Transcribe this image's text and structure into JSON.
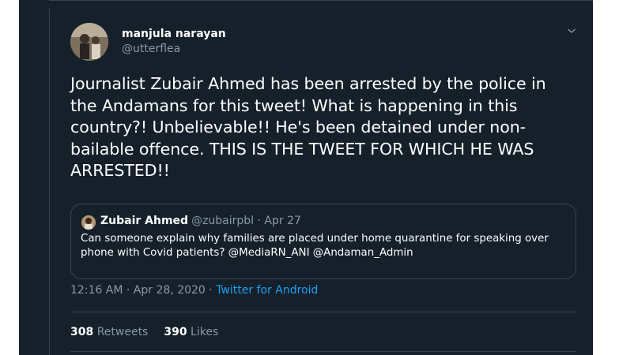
{
  "tweet": {
    "author_name": "manjula narayan",
    "author_handle": "@utterflea",
    "text": "Journalist Zubair Ahmed has been arrested by the police in the Andamans for this tweet! What is happening in this country?! Unbelievable!! He's been detained under non-bailable offence. THIS IS THE TWEET FOR WHICH HE WAS ARRESTED!!",
    "timestamp": "12:16 AM · Apr 28, 2020",
    "separator": " · ",
    "source": "Twitter for Android",
    "retweets_count": "308",
    "retweets_label": "Retweets",
    "likes_count": "390",
    "likes_label": "Likes"
  },
  "quoted": {
    "author_name": "Zubair Ahmed",
    "meta": "@zubairpbl · Apr 27",
    "text": "Can someone explain why families are placed under home quarantine for speaking over phone with Covid patients? @MediaRN_ANI @Andaman_Admin"
  },
  "colors": {
    "background": "#15202b",
    "border": "#38444d",
    "secondary_text": "#8899a6",
    "link": "#1da1f2"
  }
}
